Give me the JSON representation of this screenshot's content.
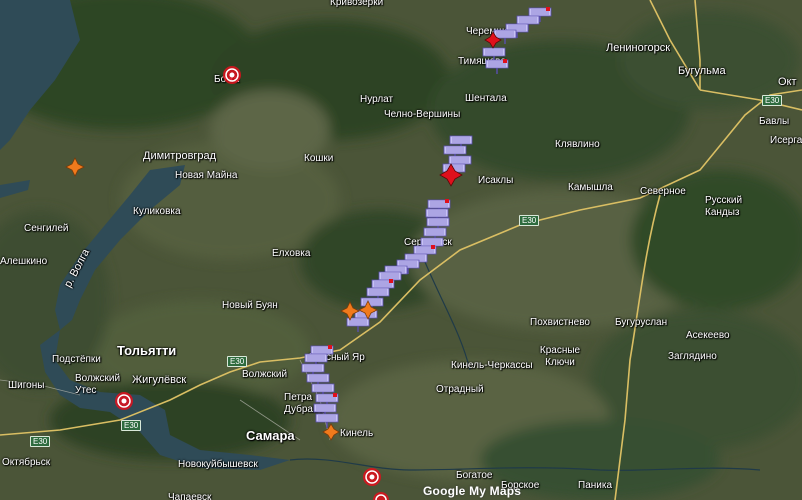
{
  "map": {
    "attribution": "Google My Maps",
    "colors": {
      "forest": "#27421f",
      "field": "#56603f",
      "water": "#2f4b57",
      "road": "#e8c76a",
      "track_marker": "#c7c2f5",
      "track_marker_edge": "#5a4fb0",
      "accent_red": "#e0101c",
      "accent_orange": "#f07a1c"
    },
    "places": [
      {
        "name": "Кривозерки"
      },
      {
        "name": "Черемшан"
      },
      {
        "name": "Тимяшево"
      },
      {
        "name": "Лениногорск"
      },
      {
        "name": "Бугульма"
      },
      {
        "name": "Окт"
      },
      {
        "name": "Бавлы"
      },
      {
        "name": "Исерга"
      },
      {
        "name": "Бо ка"
      },
      {
        "name": "Нурлат"
      },
      {
        "name": "Шентала"
      },
      {
        "name": "Челно-Вершины"
      },
      {
        "name": "Клявлино"
      },
      {
        "name": "Димитровград"
      },
      {
        "name": "Новая Майна"
      },
      {
        "name": "Кошки"
      },
      {
        "name": "Исаклы"
      },
      {
        "name": "Камышла"
      },
      {
        "name": "Северное"
      },
      {
        "name": "Русский Кандыз"
      },
      {
        "name": "Сенгилей"
      },
      {
        "name": "Куликовка"
      },
      {
        "name": "Елховка"
      },
      {
        "name": "Алешкино"
      },
      {
        "name": "р. Волга"
      },
      {
        "name": "Сергиевск"
      },
      {
        "name": "Новый Буян"
      },
      {
        "name": "Похвистнево"
      },
      {
        "name": "Бугуруслан"
      },
      {
        "name": "Асекеево"
      },
      {
        "name": "Заглядино"
      },
      {
        "name": "Тольятти"
      },
      {
        "name": "Подстёпки"
      },
      {
        "name": "Волжский Утес"
      },
      {
        "name": "Жигулёвск"
      },
      {
        "name": "Волжский"
      },
      {
        "name": "Красный Яр"
      },
      {
        "name": "Кинель-Черкассы"
      },
      {
        "name": "Красные Ключи"
      },
      {
        "name": "Отрадный"
      },
      {
        "name": "Шигоны"
      },
      {
        "name": "Петра Дубрава"
      },
      {
        "name": "Самара"
      },
      {
        "name": "Кинель"
      },
      {
        "name": "Октябрьск"
      },
      {
        "name": "Новокуйбышевск"
      },
      {
        "name": "Богатое"
      },
      {
        "name": "Борское"
      },
      {
        "name": "Паника"
      },
      {
        "name": "Чапаевск"
      }
    ],
    "roads": [
      {
        "label": "E30"
      },
      {
        "label": "E30"
      },
      {
        "label": "E30"
      },
      {
        "label": "E30"
      },
      {
        "label": "E30"
      }
    ]
  }
}
